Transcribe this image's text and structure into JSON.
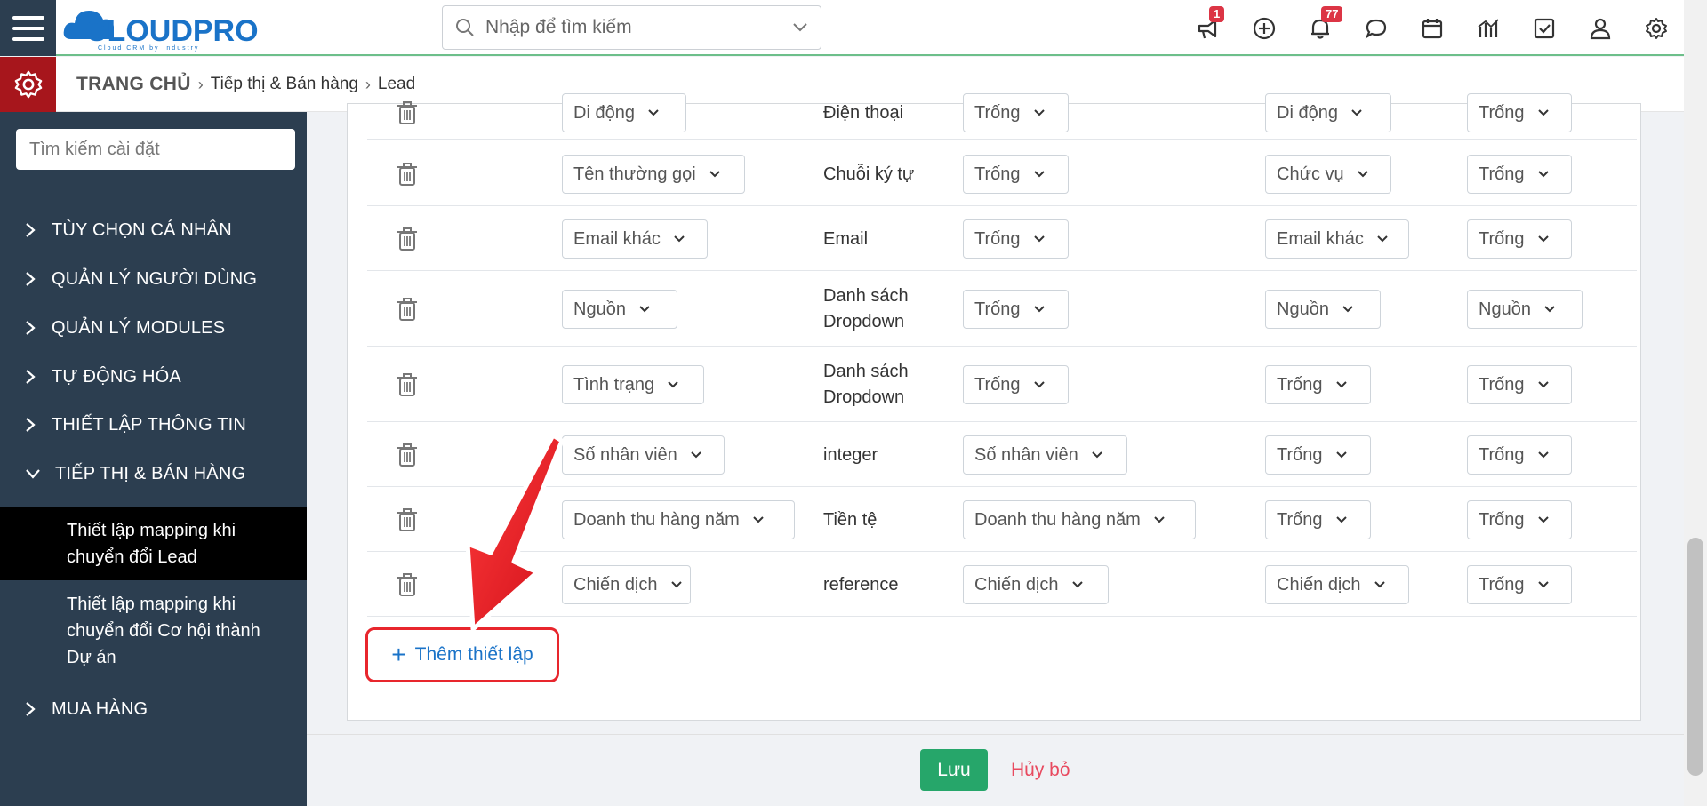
{
  "header": {
    "logo_text": "CLOUDPRO",
    "logo_tagline": "Cloud CRM by Industry",
    "search_placeholder": "Nhập để tìm kiếm",
    "badges": {
      "announcements": "1",
      "notifications": "77"
    }
  },
  "breadcrumb": {
    "home": "TRANG CHỦ",
    "level1": "Tiếp thị & Bán hàng",
    "level2": "Lead"
  },
  "sidebar": {
    "search_placeholder": "Tìm kiếm cài đặt",
    "items": [
      "TÙY CHỌN CÁ NHÂN",
      "QUẢN LÝ NGƯỜI DÙNG",
      "QUẢN LÝ MODULES",
      "TỰ ĐỘNG HÓA",
      "THIẾT LẬP THÔNG TIN",
      "TIẾP THỊ & BÁN HÀNG"
    ],
    "sub_items": [
      "Thiết lập mapping khi chuyển đổi Lead",
      "Thiết lập mapping khi chuyển đổi Cơ hội thành Dự án"
    ],
    "last_item": "MUA HÀNG"
  },
  "rows": [
    {
      "field": "Di động",
      "type": "Điện thoại",
      "col3": "Trống",
      "col4": "Di động",
      "col5": "Trống"
    },
    {
      "field": "Tên thường gọi",
      "type": "Chuỗi ký tự",
      "col3": "Trống",
      "col4": "Chức vụ",
      "col5": "Trống"
    },
    {
      "field": "Email khác",
      "type": "Email",
      "col3": "Trống",
      "col4": "Email khác",
      "col5": "Trống"
    },
    {
      "field": "Nguồn",
      "type": "Danh sách Dropdown",
      "col3": "Trống",
      "col4": "Nguồn",
      "col5": "Nguồn"
    },
    {
      "field": "Tình trạng",
      "type": "Danh sách Dropdown",
      "col3": "Trống",
      "col4": "Trống",
      "col5": "Trống"
    },
    {
      "field": "Số nhân viên",
      "type": "integer",
      "col3": "Số nhân viên",
      "col4": "Trống",
      "col5": "Trống"
    },
    {
      "field": "Doanh thu hàng năm",
      "type": "Tiền tệ",
      "col3": "Doanh thu hàng năm",
      "col4": "Trống",
      "col5": "Trống"
    },
    {
      "field": "Chiến dịch",
      "type": "reference",
      "col3": "Chiến dịch",
      "col4": "Chiến dịch",
      "col5": "Trống"
    }
  ],
  "actions": {
    "add_label": "Thêm thiết lập",
    "save_label": "Lưu",
    "cancel_label": "Hủy bỏ"
  },
  "colors": {
    "sidebar_bg": "#2c3e50",
    "accent_red": "#a7161c",
    "save_green": "#26a66a",
    "link_blue": "#1a73c8",
    "highlight_red": "#e8262d"
  }
}
